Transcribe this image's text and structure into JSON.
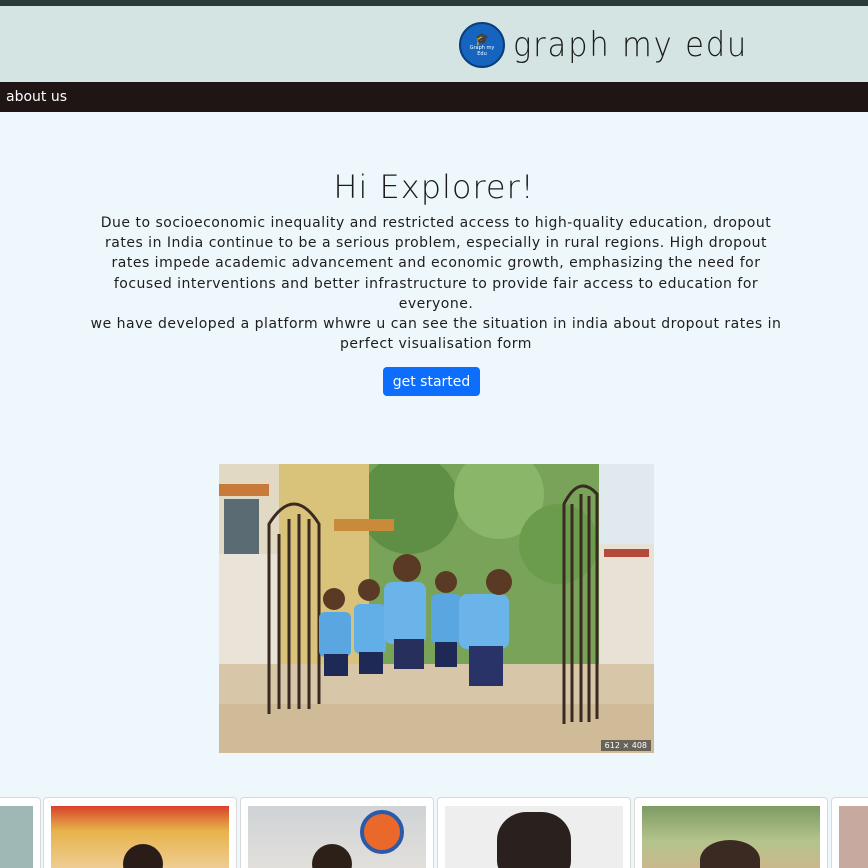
{
  "header": {
    "logo_text": "Graph my Edu",
    "brand": "graph my edu"
  },
  "nav": {
    "about": "about us"
  },
  "hero": {
    "title": "Hi Explorer!",
    "paragraph1": "Due to socioeconomic inequality and restricted access to high-quality education, dropout rates in India continue to be a serious problem, especially in rural regions. High dropout rates impede academic advancement and economic growth, emphasizing the need for focused interventions and better infrastructure to provide fair access to education for everyone.",
    "paragraph2": "we have developed a platform whwre u can see the situation in india about dropout rates in perfect visualisation form",
    "cta_label": "get started"
  },
  "photo": {
    "badge": "612 × 408"
  },
  "colors": {
    "accent": "#0d6efd",
    "navbar": "#1f1515",
    "header": "#d3e4e3",
    "background": "#eef7fb"
  }
}
